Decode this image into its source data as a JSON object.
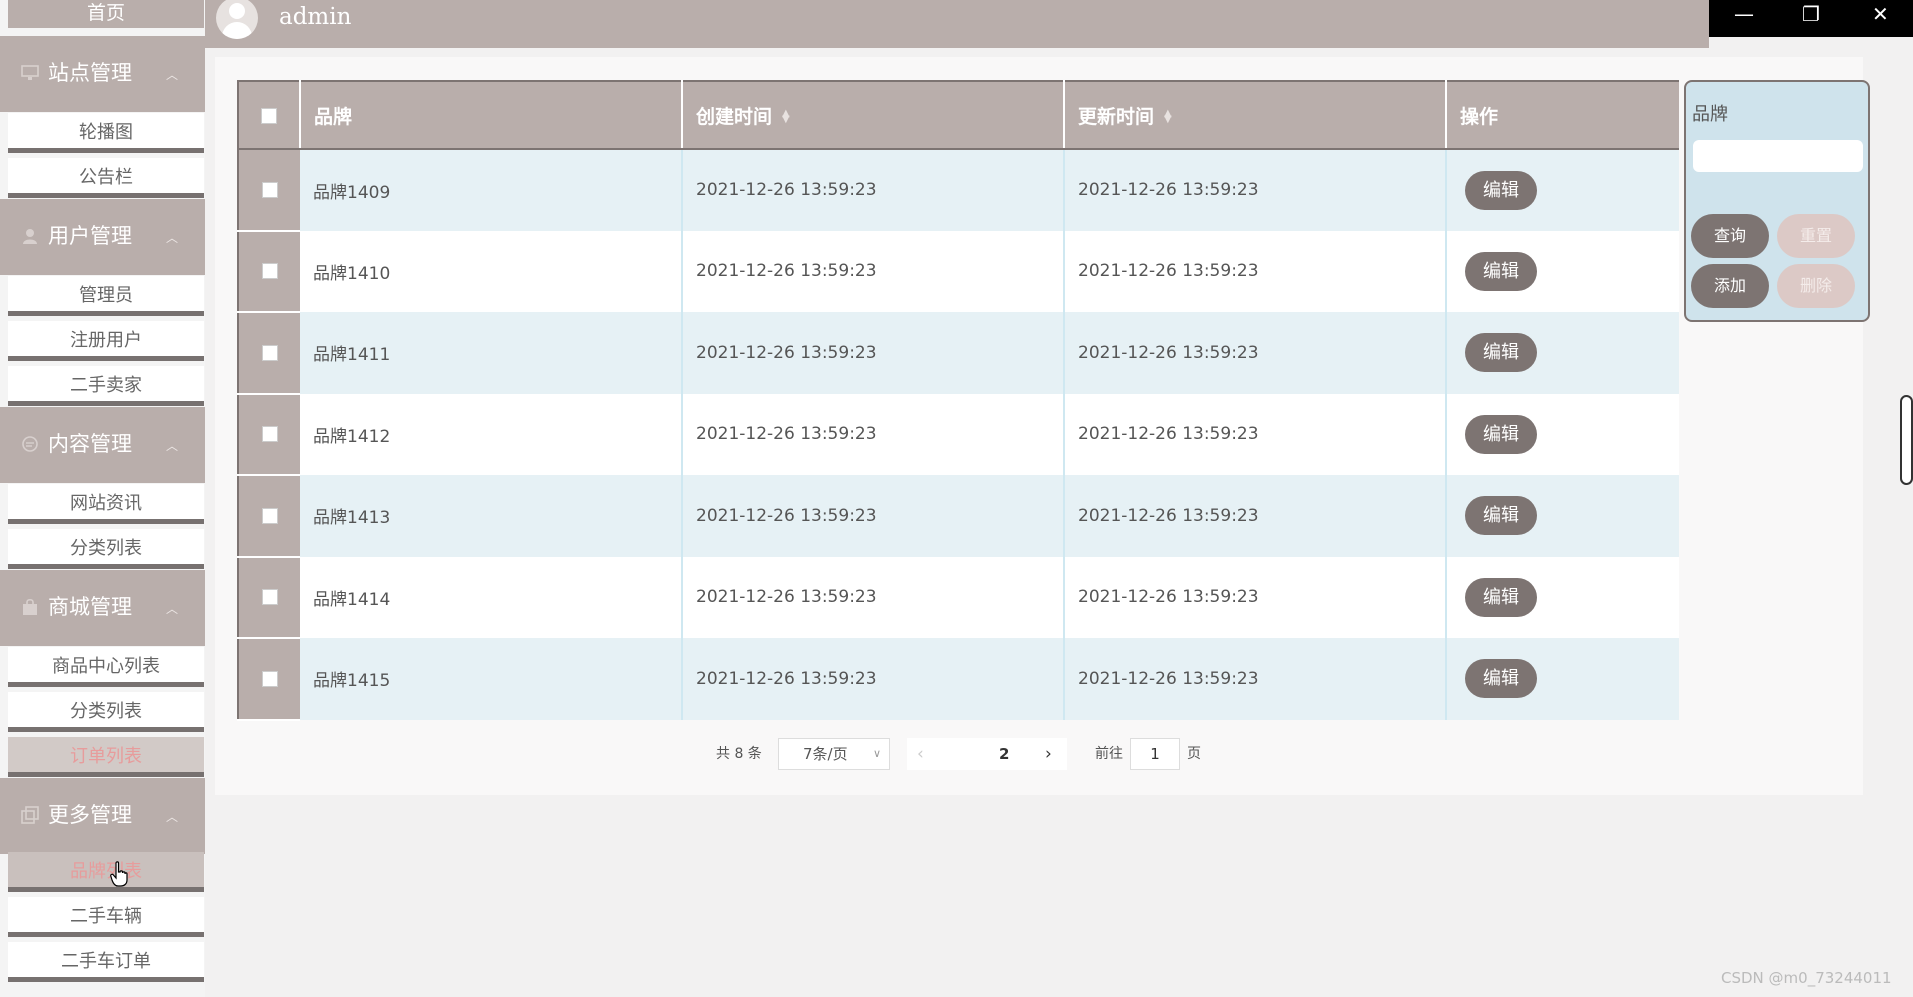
{
  "header": {
    "username": "admin"
  },
  "window_controls": {
    "minimize": "—",
    "restore": "❐",
    "close": "✕"
  },
  "sidebar": {
    "home": "首页",
    "groups": [
      {
        "title": "站点管理",
        "icon": "monitor-icon",
        "items": [
          "轮播图",
          "公告栏"
        ]
      },
      {
        "title": "用户管理",
        "icon": "user-icon",
        "items": [
          "管理员",
          "注册用户",
          "二手卖家"
        ]
      },
      {
        "title": "内容管理",
        "icon": "chat-icon",
        "items": [
          "网站资讯",
          "分类列表"
        ]
      },
      {
        "title": "商城管理",
        "icon": "bag-icon",
        "items": [
          "商品中心列表",
          "分类列表",
          "订单列表"
        ]
      },
      {
        "title": "更多管理",
        "icon": "copy-icon",
        "items": [
          "品牌列表",
          "二手车辆",
          "二手车订单"
        ]
      }
    ]
  },
  "table": {
    "columns": [
      "品牌",
      "创建时间",
      "更新时间",
      "操作"
    ],
    "rows": [
      {
        "brand": "品牌1409",
        "created": "2021-12-26 13:59:23",
        "updated": "2021-12-26 13:59:23"
      },
      {
        "brand": "品牌1410",
        "created": "2021-12-26 13:59:23",
        "updated": "2021-12-26 13:59:23"
      },
      {
        "brand": "品牌1411",
        "created": "2021-12-26 13:59:23",
        "updated": "2021-12-26 13:59:23"
      },
      {
        "brand": "品牌1412",
        "created": "2021-12-26 13:59:23",
        "updated": "2021-12-26 13:59:23"
      },
      {
        "brand": "品牌1413",
        "created": "2021-12-26 13:59:23",
        "updated": "2021-12-26 13:59:23"
      },
      {
        "brand": "品牌1414",
        "created": "2021-12-26 13:59:23",
        "updated": "2021-12-26 13:59:23"
      },
      {
        "brand": "品牌1415",
        "created": "2021-12-26 13:59:23",
        "updated": "2021-12-26 13:59:23"
      }
    ],
    "edit_label": "编辑"
  },
  "search": {
    "label": "品牌",
    "value": "",
    "query_label": "查询",
    "reset_label": "重置",
    "add_label": "添加",
    "delete_label": "删除"
  },
  "pagination": {
    "total": "共 8 条",
    "page_size": "7条/页",
    "current_page": "2",
    "goto_prefix": "前往",
    "goto_value": "1",
    "goto_suffix": "页"
  },
  "watermark": "CSDN @m0_73244011",
  "colors": {
    "accent": "#b9aeab",
    "dark": "#7d7472",
    "row_alt": "#e6f1f5",
    "search_bg": "#cfe3ec"
  }
}
